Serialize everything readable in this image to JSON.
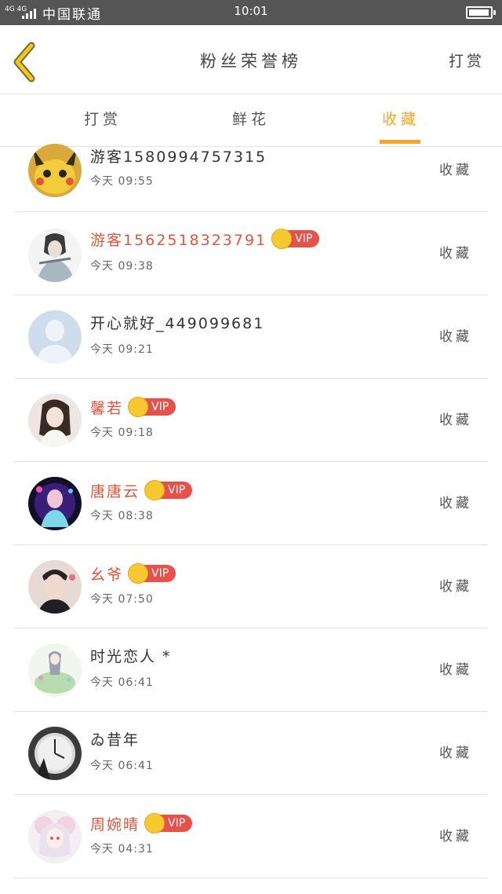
{
  "status_bar": {
    "network": "4G 4G",
    "carrier": "中国联通",
    "time": "10:01"
  },
  "header": {
    "title": "粉丝荣誉榜",
    "action": "打赏"
  },
  "tabs": [
    {
      "label": "打赏",
      "active": false
    },
    {
      "label": "鲜花",
      "active": false
    },
    {
      "label": "收藏",
      "active": true
    }
  ],
  "colors": {
    "accent": "#f5a623",
    "vip_name": "#e0563e",
    "vip_badge": "#e8514a",
    "crown": "#f7c930"
  },
  "rows": [
    {
      "name": "游客1580994757315",
      "time": "今天 09:55",
      "vip": false,
      "vip_label": "",
      "action": "收藏",
      "avatar": "pikachu-avatar"
    },
    {
      "name": "游客1562518323791",
      "time": "今天 09:38",
      "vip": true,
      "vip_label": "VIP",
      "action": "收藏",
      "avatar": "sketch-portrait-avatar"
    },
    {
      "name": "开心就好_449099681",
      "time": "今天 09:21",
      "vip": false,
      "vip_label": "",
      "action": "收藏",
      "avatar": "default-avatar"
    },
    {
      "name": "馨若",
      "time": "今天 09:18",
      "vip": true,
      "vip_label": "VIP",
      "action": "收藏",
      "avatar": "girl-photo-avatar"
    },
    {
      "name": "唐唐云",
      "time": "今天 08:38",
      "vip": true,
      "vip_label": "VIP",
      "action": "收藏",
      "avatar": "neon-girl-avatar"
    },
    {
      "name": "幺爷",
      "time": "今天 07:50",
      "vip": true,
      "vip_label": "VIP",
      "action": "收藏",
      "avatar": "man-photo-avatar"
    },
    {
      "name": "时光恋人 *",
      "time": "今天 06:41",
      "vip": false,
      "vip_label": "",
      "action": "收藏",
      "avatar": "illustration-avatar"
    },
    {
      "name": "ゐ昔年",
      "time": "今天 06:41",
      "vip": false,
      "vip_label": "",
      "action": "收藏",
      "avatar": "clock-avatar"
    },
    {
      "name": "周婉晴",
      "time": "今天 04:31",
      "vip": true,
      "vip_label": "VIP",
      "action": "收藏",
      "avatar": "anime-girl-avatar"
    }
  ]
}
